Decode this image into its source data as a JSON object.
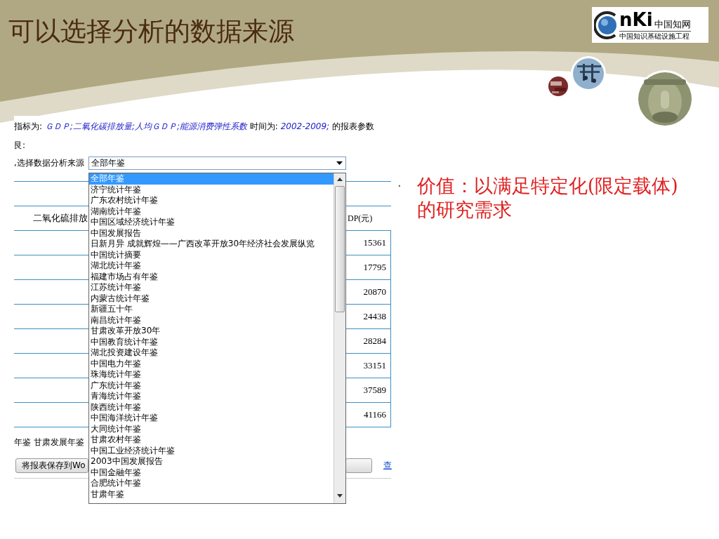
{
  "slide": {
    "title": "可以选择分析的数据来源",
    "logo": {
      "mark": "nKi",
      "name": "中国知网",
      "tagline": "中国知识基础设施工程"
    }
  },
  "screenshot": {
    "params": [
      {
        "kind": "label",
        "text": "指标为: "
      },
      {
        "kind": "value",
        "text": "ＧＤＰ;二氧化碳排放量;人均ＧＤＰ;能源消费弹性系数"
      },
      {
        "kind": "label",
        "text": " 时间为: "
      },
      {
        "kind": "value",
        "text": "2002-2009;"
      },
      {
        "kind": "label",
        "text": " 的报表参数"
      }
    ],
    "line2": "艮:",
    "source_label": ",选择数据分析来源",
    "source_select": {
      "value": "全部年鉴",
      "options": [
        {
          "label": "全部年鉴",
          "selected": true
        },
        {
          "label": "济宁统计年鉴",
          "selected": false
        },
        {
          "label": "广东农村统计年鉴",
          "selected": false
        },
        {
          "label": "湖南统计年鉴",
          "selected": false
        },
        {
          "label": "中国区域经济统计年鉴",
          "selected": false
        },
        {
          "label": "中国发展报告",
          "selected": false
        },
        {
          "label": "日新月异 成就辉煌——广西改革开放30年经济社会发展纵览",
          "selected": false
        },
        {
          "label": "中国统计摘要",
          "selected": false
        },
        {
          "label": "湖北统计年鉴",
          "selected": false
        },
        {
          "label": "福建市场占有年鉴",
          "selected": false
        },
        {
          "label": "江苏统计年鉴",
          "selected": false
        },
        {
          "label": "内蒙古统计年鉴",
          "selected": false
        },
        {
          "label": "新疆五十年",
          "selected": false
        },
        {
          "label": "南昌统计年鉴",
          "selected": false
        },
        {
          "label": "甘肃改革开放30年",
          "selected": false
        },
        {
          "label": "中国教育统计年鉴",
          "selected": false
        },
        {
          "label": "湖北投资建设年鉴",
          "selected": false
        },
        {
          "label": "中国电力年鉴",
          "selected": false
        },
        {
          "label": "珠海统计年鉴",
          "selected": false
        },
        {
          "label": "广东统计年鉴",
          "selected": false
        },
        {
          "label": "青海统计年鉴",
          "selected": false
        },
        {
          "label": "陕西统计年鉴",
          "selected": false
        },
        {
          "label": "中国海洋统计年鉴",
          "selected": false
        },
        {
          "label": "大同统计年鉴",
          "selected": false
        },
        {
          "label": "甘肃农村年鉴",
          "selected": false
        },
        {
          "label": "中国工业经济统计年鉴",
          "selected": false
        },
        {
          "label": "2003中国发展报告",
          "selected": false
        },
        {
          "label": "中国金融年鉴",
          "selected": false
        },
        {
          "label": "合肥统计年鉴",
          "selected": false
        },
        {
          "label": "甘肃年鉴",
          "selected": false
        }
      ]
    },
    "table": {
      "header": [
        "二氧化硫排放",
        "DP(元)"
      ],
      "values": [
        "15361",
        "17795",
        "20870",
        "24438",
        "28284",
        "33151",
        "37589",
        "41166"
      ]
    },
    "footer_text": "年鉴 甘肃发展年鉴",
    "buttons": [
      "将报表保存到Wo"
    ],
    "link": "查"
  },
  "bullets": [
    {
      "marker": "·",
      "text": "价值：以满足特定化(限定载体)的研究需求"
    }
  ]
}
